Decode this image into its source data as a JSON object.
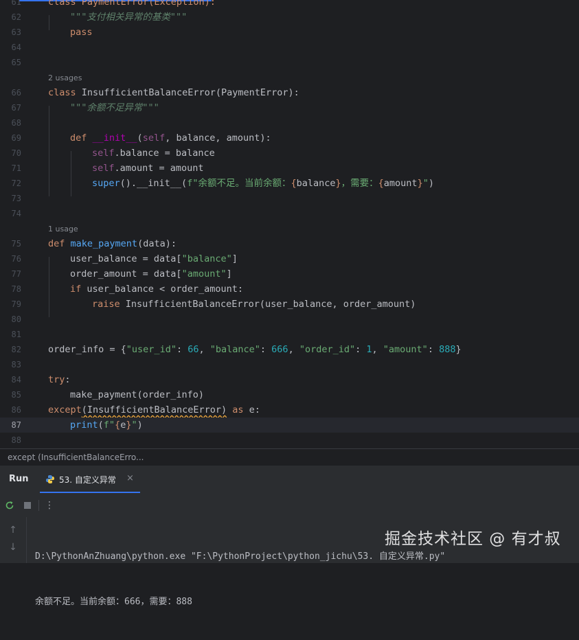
{
  "editor": {
    "partial_top_line": {
      "number": "61",
      "text": "class PaymentError(Exception):"
    },
    "usage_hints": {
      "first": "2 usages",
      "second": "1 usage"
    },
    "lines": {
      "l62": {
        "number": "62",
        "text": "\"\"\"支付相关异常的基类\"\"\""
      },
      "l63": {
        "number": "63",
        "text": "pass"
      },
      "l64": {
        "number": "64"
      },
      "l65": {
        "number": "65"
      },
      "l66": {
        "number": "66",
        "kw": "class ",
        "name": "InsufficientBalanceError(PaymentError):"
      },
      "l67": {
        "number": "67",
        "text": "\"\"\"余额不足异常\"\"\""
      },
      "l68": {
        "number": "68"
      },
      "l69": {
        "number": "69",
        "kw": "def ",
        "dunder": "__init__",
        "p1": "(",
        "self": "self",
        "p2": ", balance, amount):"
      },
      "l70": {
        "number": "70",
        "self": "self",
        "rest": ".balance = balance"
      },
      "l71": {
        "number": "71",
        "self": "self",
        "rest": ".amount = amount"
      },
      "l72": {
        "number": "72",
        "super": "super",
        "a": "().__init__(",
        "f": "f\"余额不足。当前余额：",
        "b1": "{",
        "v1": "balance",
        "b2": "}",
        "mid": "，需要：",
        "b3": "{",
        "v2": "amount",
        "b4": "}",
        "q": "\"",
        "close": ")"
      },
      "l73": {
        "number": "73"
      },
      "l74": {
        "number": "74"
      },
      "l75": {
        "number": "75",
        "kw": "def ",
        "fn": "make_payment",
        "rest": "(data):"
      },
      "l76": {
        "number": "76",
        "a": "user_balance = data[",
        "s": "\"balance\"",
        "b": "]"
      },
      "l77": {
        "number": "77",
        "a": "order_amount = data[",
        "s": "\"amount\"",
        "b": "]"
      },
      "l78": {
        "number": "78",
        "kw": "if ",
        "rest": "user_balance < order_amount:"
      },
      "l79": {
        "number": "79",
        "kw": "raise ",
        "rest": "InsufficientBalanceError(user_balance, order_amount)"
      },
      "l80": {
        "number": "80"
      },
      "l81": {
        "number": "81"
      },
      "l82": {
        "number": "82",
        "a": "order_info = {",
        "k1": "\"user_id\"",
        "c1": ": ",
        "n1": "66",
        "sep1": ", ",
        "k2": "\"balance\"",
        "c2": ": ",
        "n2": "666",
        "sep2": ", ",
        "k3": "\"order_id\"",
        "c3": ": ",
        "n3": "1",
        "sep3": ", ",
        "k4": "\"amount\"",
        "c4": ": ",
        "n4": "888",
        "end": "}"
      },
      "l83": {
        "number": "83"
      },
      "l84": {
        "number": "84",
        "kw": "try",
        "rest": ":"
      },
      "l85": {
        "number": "85",
        "text": "make_payment(order_info)"
      },
      "l86": {
        "number": "86",
        "kw": "except",
        "squig": "(InsufficientBalanceError)",
        "kw2": " as ",
        "rest": "e:"
      },
      "l87": {
        "number": "87",
        "fn": "print",
        "a": "(",
        "f": "f\"",
        "b1": "{",
        "v": "e",
        "b2": "}",
        "q": "\"",
        "close": ")"
      },
      "l88": {
        "number": "88"
      }
    }
  },
  "breadcrumb": "except (InsufficientBalanceErro...",
  "run_panel": {
    "title": "Run",
    "tab_label": "53. 自定义异常",
    "tab_close": "×",
    "more": "⋮",
    "up": "↑",
    "down": "↓",
    "console": {
      "line1": "D:\\PythonAnZhuang\\python.exe \"F:\\PythonProject\\python_jichu\\53. 自定义异常.py\"",
      "line2": "余额不足。当前余额：666，需要：888"
    }
  },
  "watermark": "掘金技术社区 @ 有才叔",
  "colors": {
    "accent": "#3574f0",
    "keyword": "#cf8e6d",
    "function": "#56a8f5",
    "string": "#6aab73",
    "number": "#2aacb8"
  }
}
